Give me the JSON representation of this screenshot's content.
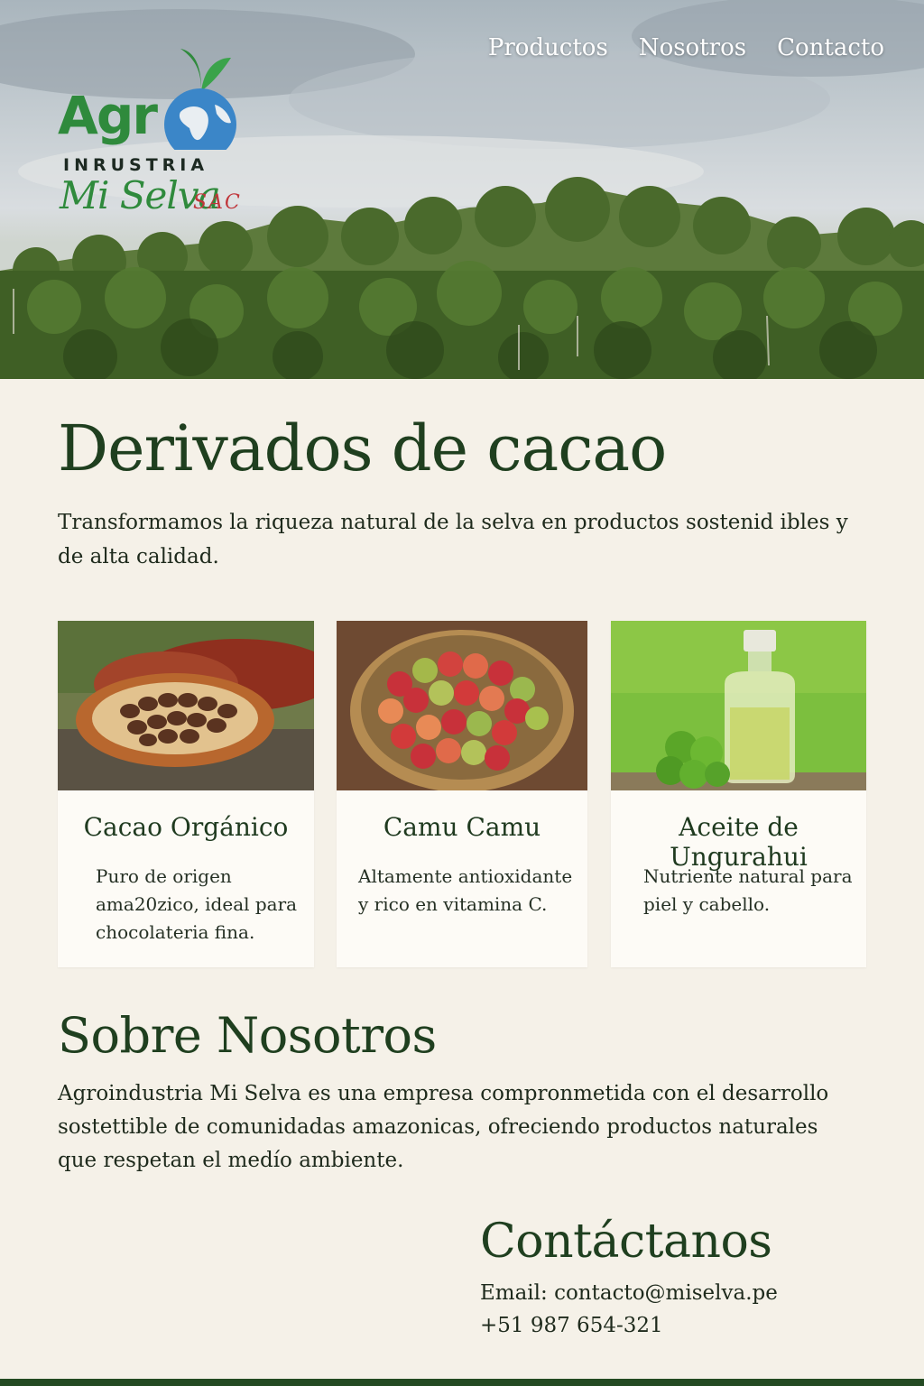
{
  "nav": {
    "items": [
      "Productos",
      "Nosotros",
      "Contacto"
    ]
  },
  "logo": {
    "line1": "Agr",
    "line2": "INRUSTRIA",
    "line3": "Mi Selva",
    "suffix": "SAC"
  },
  "main": {
    "title": "Derivados de cacao",
    "intro": "Transformamos la riqueza natural de la selva en productos sostenid ibles y de alta calidad."
  },
  "products": [
    {
      "name": "Cacao Orgánico",
      "description": "Puro de origen ama20zico, ideal para chocolateria fina."
    },
    {
      "name": "Camu Camu",
      "description": "Altamente antioxidante y rico en vitamina C."
    },
    {
      "name": "Aceite de Ungurahui",
      "description": "Nutriente natural para piel y cabello."
    }
  ],
  "about": {
    "heading": "Sobre Nosotros",
    "text": "Agroindustria Mi Selva es una empresa compronmetida con el desarrollo sostettible de comunidadas amazonicas, ofreciendo productos naturales que respetan el medío ambiente."
  },
  "contact": {
    "heading": "Contáctanos",
    "email": "Email: contacto@miselva.pe",
    "phone": "+51 987 654-321"
  },
  "colors": {
    "brand_green": "#2f8a3c",
    "heading_green": "#1f3f1f",
    "accent_red": "#c0353a",
    "page_bg": "#f5f1e8",
    "footer_bar": "#234a22"
  },
  "icons": {
    "logo_globe": "globe-icon",
    "logo_sprout": "sprout-icon"
  }
}
